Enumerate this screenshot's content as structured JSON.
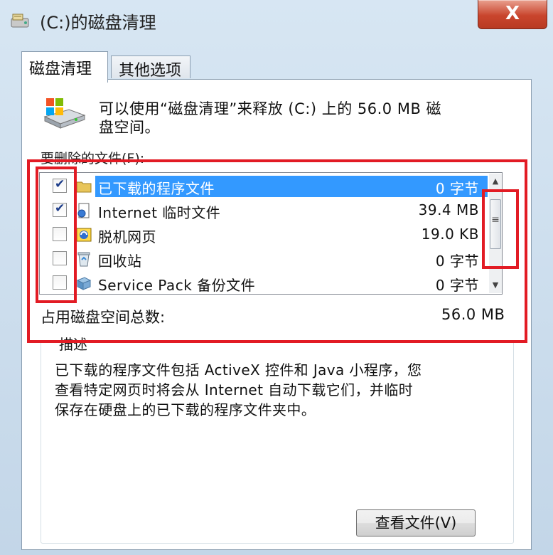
{
  "window": {
    "title": "(C:)的磁盘清理",
    "close_label": "X"
  },
  "tabs": [
    {
      "label": "磁盘清理",
      "active": true
    },
    {
      "label": "其他选项",
      "active": false
    }
  ],
  "intro": {
    "line1": "可以使用“磁盘清理”来释放  (C:) 上的 56.0 MB 磁",
    "line2": "盘空间。"
  },
  "files_label": "要删除的文件(F):",
  "files": [
    {
      "name": "已下载的程序文件",
      "size": "0 字节",
      "checked": true,
      "selected": true,
      "icon": "folder-icon"
    },
    {
      "name": "Internet 临时文件",
      "size": "39.4 MB",
      "checked": true,
      "selected": false,
      "icon": "internet-file-icon"
    },
    {
      "name": "脱机网页",
      "size": "19.0 KB",
      "checked": false,
      "selected": false,
      "icon": "offline-page-icon"
    },
    {
      "name": "回收站",
      "size": "0 字节",
      "checked": false,
      "selected": false,
      "icon": "recycle-bin-icon"
    },
    {
      "name": "Service Pack 备份文件",
      "size": "0 字节",
      "checked": false,
      "selected": false,
      "icon": "backup-file-icon"
    }
  ],
  "total": {
    "label": "占用磁盘空间总数:",
    "value": "56.0 MB"
  },
  "description": {
    "legend": "描述",
    "line1": "已下载的程序文件包括 ActiveX 控件和 Java 小程序，您",
    "line2": "查看特定网页时将会从 Internet 自动下载它们，并临时",
    "line3": "保存在硬盘上的已下载的程序文件夹中。"
  },
  "view_button_label": "查看文件(V)",
  "colors": {
    "selection": "#3399ff",
    "highlight_frame": "#e21b24",
    "check": "#1d3d8a"
  }
}
